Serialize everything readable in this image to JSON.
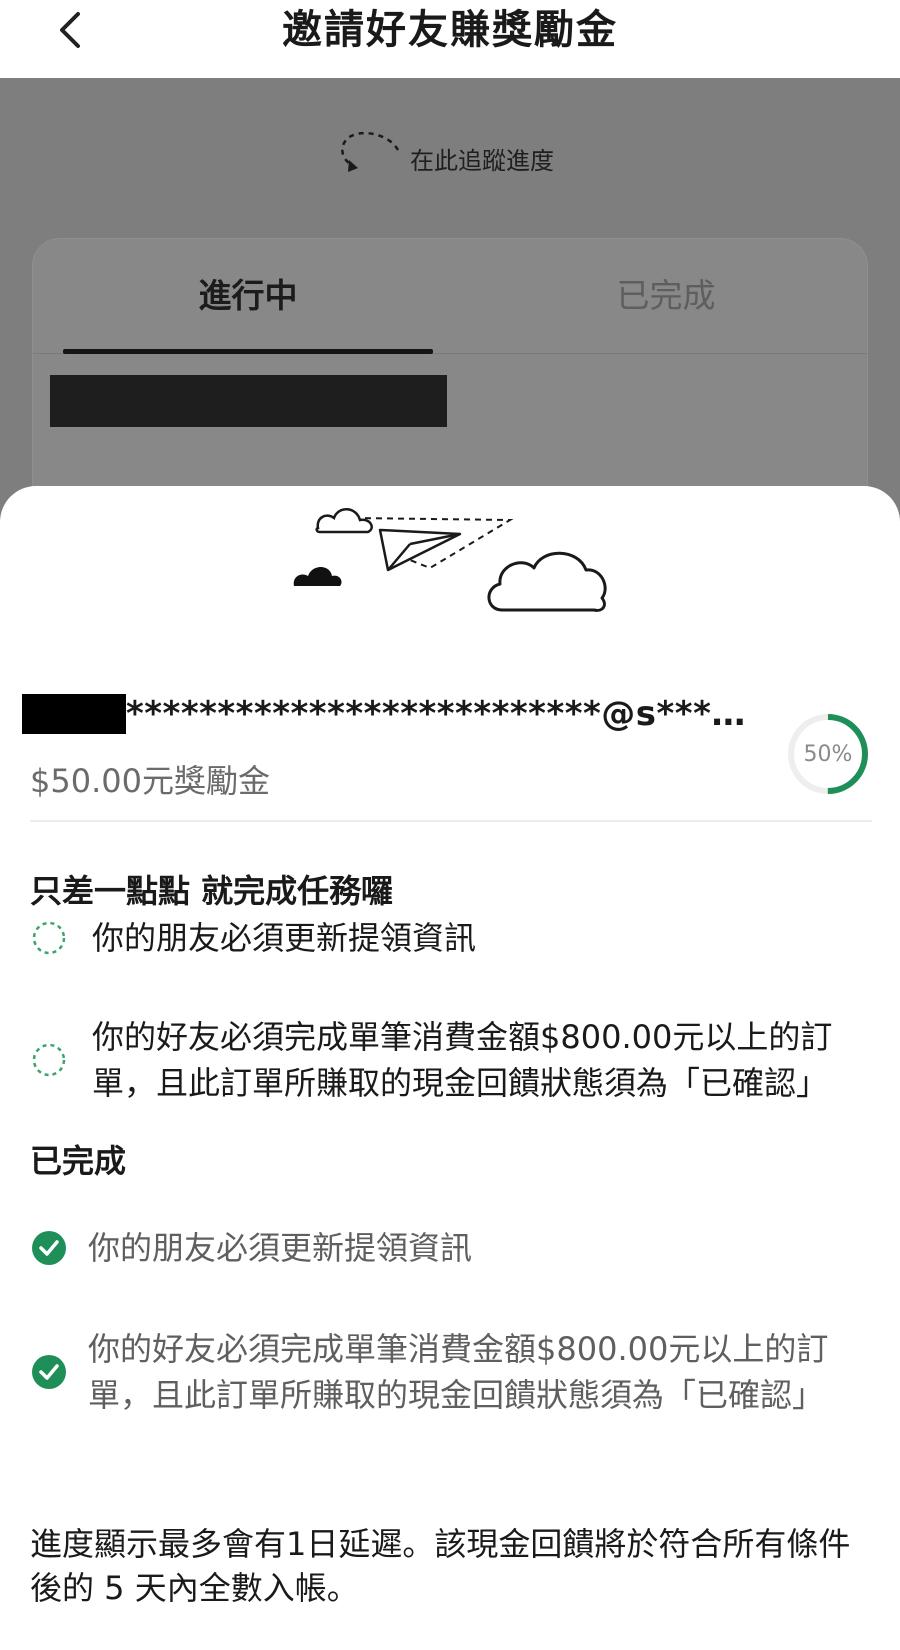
{
  "header": {
    "title": "邀請好友賺獎勵金",
    "back_icon": "chevron-left-icon"
  },
  "track_hint": {
    "text": "在此追蹤進度",
    "icon": "dashed-curved-arrow-icon"
  },
  "tabs": [
    {
      "label": "進行中",
      "active": true
    },
    {
      "label": "已完成",
      "active": false
    }
  ],
  "referral": {
    "email_masked": "**************************@s****...",
    "reward": "$50.00元獎勵金",
    "progress_percent": 50,
    "progress_label": "50%"
  },
  "pending_section": {
    "title": "只差一點點 就完成任務囉",
    "tasks": [
      {
        "text": "你的朋友必須更新提領資訊",
        "icon": "pending-dashed-circle-icon"
      },
      {
        "text": "你的好友必須完成單筆消費金額$800.00元以上的訂單，且此訂單所賺取的現金回饋狀態須為「已確認」",
        "icon": "pending-dashed-circle-icon"
      }
    ]
  },
  "completed_section": {
    "title": "已完成",
    "tasks": [
      {
        "text": "你的朋友必須更新提領資訊",
        "icon": "check-circle-icon"
      },
      {
        "text": "你的好友必須完成單筆消費金額$800.00元以上的訂單，且此訂單所賺取的現金回饋狀態須為「已確認」",
        "icon": "check-circle-icon"
      }
    ]
  },
  "footer_note": "進度顯示最多會有1日延遲。該現金回饋將於符合所有條件後的 5 天內全數入帳。",
  "colors": {
    "accent_green": "#1f8f5a",
    "dim_overlay": "#7e7e7e",
    "text_primary": "#1a1a1a",
    "text_secondary": "#6b6b6b"
  }
}
